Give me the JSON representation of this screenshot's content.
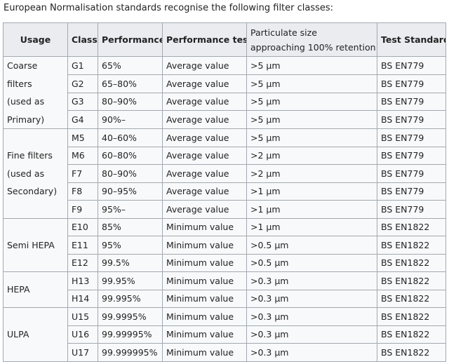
{
  "intro": "European Normalisation standards recognise the following filter classes:",
  "headers": {
    "usage": "Usage",
    "class": "Class",
    "performance": "Performance",
    "performance_test": "Performance test",
    "particulate_line1": "Particulate size",
    "particulate_line2": "approaching 100% retention",
    "test_standard": "Test Standard"
  },
  "groups": [
    {
      "usage_lines": [
        "Coarse filters",
        "(used as",
        "Primary)"
      ],
      "rows": [
        {
          "class": "G1",
          "performance": "65%",
          "test": "Average value",
          "size": ">5 µm",
          "standard": "BS EN779"
        },
        {
          "class": "G2",
          "performance": "65–80%",
          "test": "Average value",
          "size": ">5 µm",
          "standard": "BS EN779"
        },
        {
          "class": "G3",
          "performance": "80–90%",
          "test": "Average value",
          "size": ">5 µm",
          "standard": "BS EN779"
        },
        {
          "class": "G4",
          "performance": "90%–",
          "test": "Average value",
          "size": ">5 µm",
          "standard": "BS EN779"
        }
      ]
    },
    {
      "usage_lines": [
        "Fine filters",
        "(used as",
        "Secondary)"
      ],
      "rows": [
        {
          "class": "M5",
          "performance": "40–60%",
          "test": "Average value",
          "size": ">5 µm",
          "standard": "BS EN779"
        },
        {
          "class": "M6",
          "performance": "60–80%",
          "test": "Average value",
          "size": ">2 µm",
          "standard": "BS EN779"
        },
        {
          "class": "F7",
          "performance": "80–90%",
          "test": "Average value",
          "size": ">2 µm",
          "standard": "BS EN779"
        },
        {
          "class": "F8",
          "performance": "90–95%",
          "test": "Average value",
          "size": ">1 µm",
          "standard": "BS EN779"
        },
        {
          "class": "F9",
          "performance": "95%–",
          "test": "Average value",
          "size": ">1 µm",
          "standard": "BS EN779"
        }
      ]
    },
    {
      "usage_lines": [
        "Semi HEPA"
      ],
      "rows": [
        {
          "class": "E10",
          "performance": "85%",
          "test": "Minimum value",
          "size": ">1 µm",
          "standard": "BS EN1822"
        },
        {
          "class": "E11",
          "performance": "95%",
          "test": "Minimum value",
          "size": ">0.5 µm",
          "standard": "BS EN1822"
        },
        {
          "class": "E12",
          "performance": "99.5%",
          "test": "Minimum value",
          "size": ">0.5 µm",
          "standard": "BS EN1822"
        }
      ]
    },
    {
      "usage_lines": [
        "HEPA"
      ],
      "rows": [
        {
          "class": "H13",
          "performance": "99.95%",
          "test": "Minimum value",
          "size": ">0.3 µm",
          "standard": "BS EN1822"
        },
        {
          "class": "H14",
          "performance": "99.995%",
          "test": "Minimum value",
          "size": ">0.3 µm",
          "standard": "BS EN1822"
        }
      ]
    },
    {
      "usage_lines": [
        "ULPA"
      ],
      "rows": [
        {
          "class": "U15",
          "performance": "99.9995%",
          "test": "Minimum value",
          "size": ">0.3 µm",
          "standard": "BS EN1822"
        },
        {
          "class": "U16",
          "performance": "99.99995%",
          "test": "Minimum value",
          "size": ">0.3 µm",
          "standard": "BS EN1822"
        },
        {
          "class": "U17",
          "performance": "99.999995%",
          "test": "Minimum value",
          "size": ">0.3 µm",
          "standard": "BS EN1822"
        }
      ]
    }
  ]
}
